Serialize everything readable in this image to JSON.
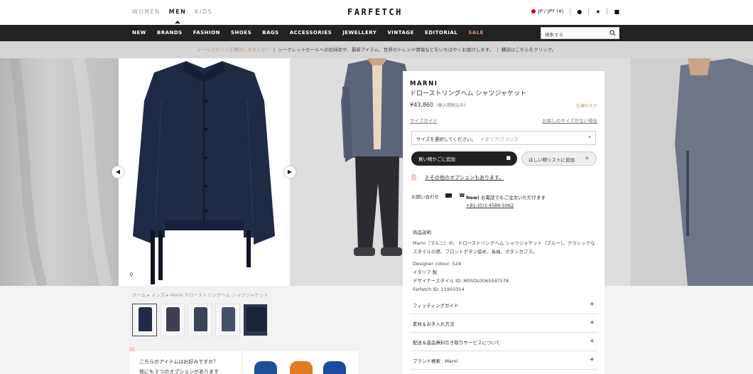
{
  "header": {
    "gender_tabs": [
      "WOMEN",
      "MEN",
      "KIDS"
    ],
    "logo": "FARFETCH",
    "locale": "JP / JPY (¥)"
  },
  "nav": {
    "items": [
      "NEW",
      "BRANDS",
      "FASHION",
      "SHOES",
      "BAGS",
      "ACCESSORIES",
      "JEWELLERY",
      "VINTAGE",
      "EDITORIAL",
      "SALE"
    ],
    "search_placeholder": "検索する"
  },
  "promo": {
    "highlight": "メールマガジンを購読しませんか？",
    "text": "シークレットセールへの招待状や、最新アイテム、世界のトレンド情報などをいちはやくお届けします。",
    "cta": "購読はこちらをクリック。"
  },
  "product": {
    "brand": "MARNI",
    "name": "ドローストリングヘム シャツジャケット",
    "price": "¥43,860",
    "tax_note": "(輸入関税込み)",
    "stock": "在庫わずか",
    "size_guide": "サイズガイド",
    "size_missing": "お探しのサイズがない場合",
    "size_select_label": "サイズを選択してください。",
    "size_select_sub": "イタリア/フランス",
    "add_to_bag": "買い物かごに追加",
    "wishlist": "ほしい物リストに追加",
    "options": "3 その他のオプションもあります。",
    "contact_label": "お問い合わせ",
    "phone_new": "New!",
    "phone_title": "お電話でもご注文いただけます",
    "phone_number": "+81-(0)3-4589-5062",
    "desc_title": "商品説明",
    "desc_body": "Marni（マルニ）の、ドローストリングヘム シャツジャケット（ブルー）。クラシックなスタイルの襟、フロントボタン留め、長袖、ボタンカフス。",
    "designer_colour": "Designer colour: 524",
    "made_in": "イタリア 製",
    "style_id": "デザイナースタイル ID: M05DL0065S47578",
    "farfetch_id": "Farfetch ID: 11903314",
    "accordions": [
      "フィッティングガイド",
      "素材＆お手入れ方法",
      "配送＆返品無料引き取りサービスについて",
      "ブランド検索 : Marni"
    ]
  },
  "breadcrumb": "ホーム ▸ メンズ ▸ Marni ドローストリングヘム シャツジャケット",
  "recommend": {
    "line1": "こちらのアイテムはお好みですか？",
    "line2": "他にも３つのオプションがあります"
  },
  "colors": {
    "jacket": "#1f2a44",
    "model_jacket": "#5b6478",
    "accent_sale": "#e98a7a",
    "accent_gold": "#b9997a"
  },
  "icons": [
    "person-icon",
    "star-icon",
    "bag-icon",
    "search-icon",
    "chevron-left-icon",
    "chevron-right-icon",
    "zoom-icon",
    "lock-icon",
    "mail-icon",
    "phone-icon",
    "plus-icon"
  ]
}
